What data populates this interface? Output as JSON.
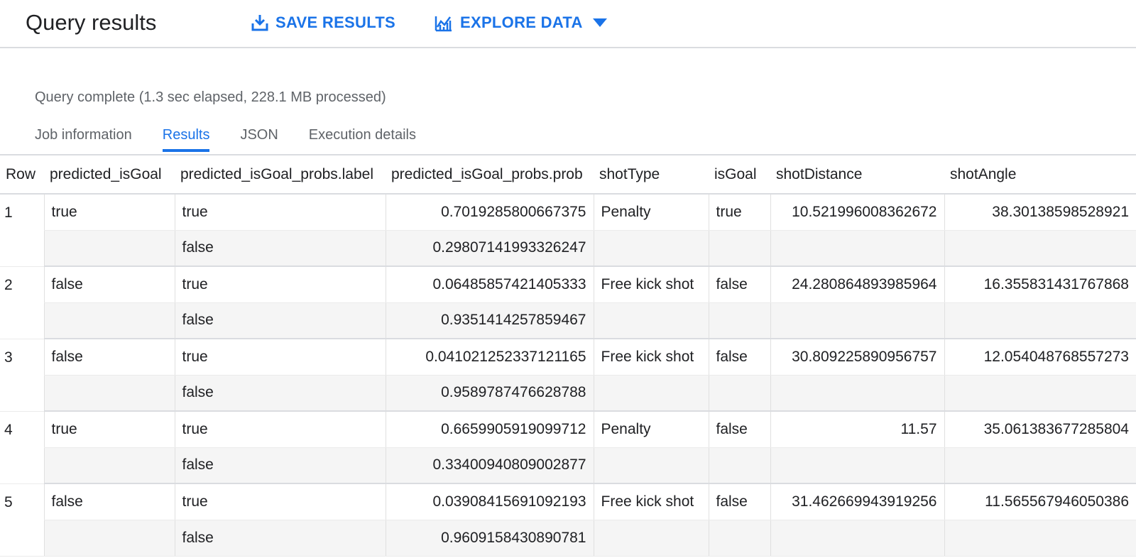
{
  "header": {
    "title": "Query results",
    "save_label": "SAVE RESULTS",
    "explore_label": "EXPLORE DATA"
  },
  "status": "Query complete (1.3 sec elapsed, 228.1 MB processed)",
  "tabs": [
    "Job information",
    "Results",
    "JSON",
    "Execution details"
  ],
  "active_tab": "Results",
  "accent_color": "#1a73e8",
  "table": {
    "columns": [
      "Row",
      "predicted_isGoal",
      "predicted_isGoal_probs.label",
      "predicted_isGoal_probs.prob",
      "shotType",
      "isGoal",
      "shotDistance",
      "shotAngle"
    ],
    "rows": [
      {
        "row": "1",
        "predicted_isGoal": "true",
        "probs": [
          {
            "label": "true",
            "prob": "0.7019285800667375"
          },
          {
            "label": "false",
            "prob": "0.29807141993326247"
          }
        ],
        "shotType": "Penalty",
        "isGoal": "true",
        "shotDistance": "10.521996008362672",
        "shotAngle": "38.30138598528921"
      },
      {
        "row": "2",
        "predicted_isGoal": "false",
        "probs": [
          {
            "label": "true",
            "prob": "0.06485857421405333"
          },
          {
            "label": "false",
            "prob": "0.9351414257859467"
          }
        ],
        "shotType": "Free kick shot",
        "isGoal": "false",
        "shotDistance": "24.280864893985964",
        "shotAngle": "16.355831431767868"
      },
      {
        "row": "3",
        "predicted_isGoal": "false",
        "probs": [
          {
            "label": "true",
            "prob": "0.041021252337121165"
          },
          {
            "label": "false",
            "prob": "0.9589787476628788"
          }
        ],
        "shotType": "Free kick shot",
        "isGoal": "false",
        "shotDistance": "30.809225890956757",
        "shotAngle": "12.054048768557273"
      },
      {
        "row": "4",
        "predicted_isGoal": "true",
        "probs": [
          {
            "label": "true",
            "prob": "0.6659905919099712"
          },
          {
            "label": "false",
            "prob": "0.33400940809002877"
          }
        ],
        "shotType": "Penalty",
        "isGoal": "false",
        "shotDistance": "11.57",
        "shotAngle": "35.061383677285804"
      },
      {
        "row": "5",
        "predicted_isGoal": "false",
        "probs": [
          {
            "label": "true",
            "prob": "0.03908415691092193"
          },
          {
            "label": "false",
            "prob": "0.9609158430890781"
          }
        ],
        "shotType": "Free kick shot",
        "isGoal": "false",
        "shotDistance": "31.462669943919256",
        "shotAngle": "11.565567946050386"
      }
    ]
  }
}
